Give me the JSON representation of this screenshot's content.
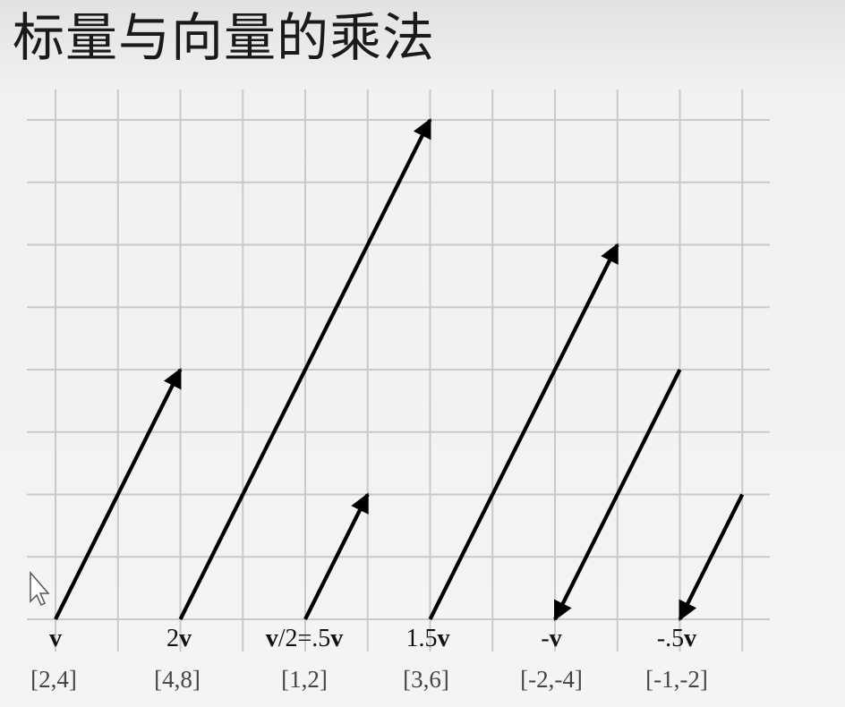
{
  "title": "标量与向量的乘法",
  "vectors": [
    {
      "label_prefix": "",
      "label_bold": "v",
      "coords": "[2,4]",
      "x": 2,
      "y": 4
    },
    {
      "label_prefix": "2",
      "label_bold": "v",
      "coords": "[4,8]",
      "x": 4,
      "y": 8
    },
    {
      "label_prefix": "",
      "label_bold": "v",
      "label_mid": "/2=.5",
      "label_bold2": "v",
      "coords": "[1,2]",
      "x": 1,
      "y": 2
    },
    {
      "label_prefix": "1.5",
      "label_bold": "v",
      "coords": "[3,6]",
      "x": 3,
      "y": 6
    },
    {
      "label_prefix": "-",
      "label_bold": "v",
      "coords": "[-2,-4]",
      "x": -2,
      "y": -4
    },
    {
      "label_prefix": "-.5",
      "label_bold": "v",
      "coords": "[-1,-2]",
      "x": -1,
      "y": -2
    }
  ]
}
